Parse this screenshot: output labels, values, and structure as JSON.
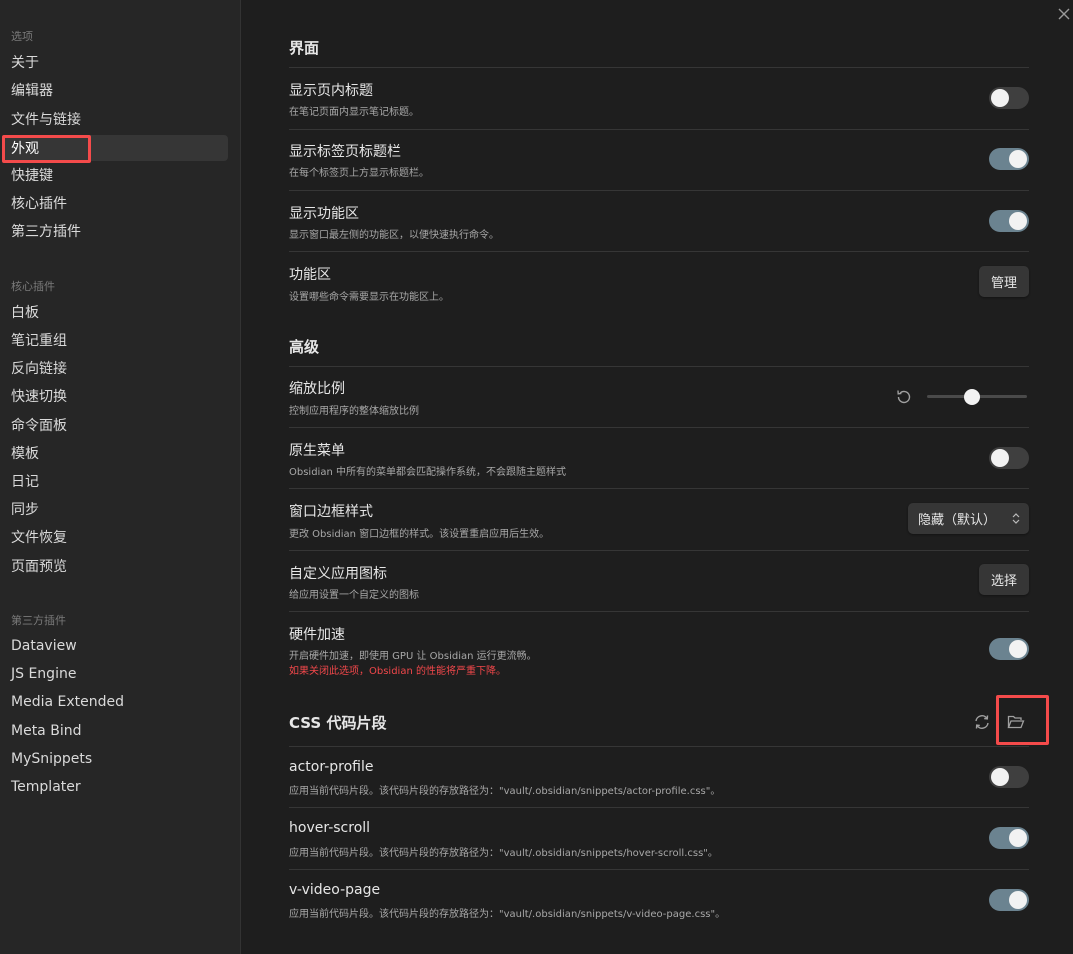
{
  "sidebar": {
    "group_options": "选项",
    "options": [
      "关于",
      "编辑器",
      "文件与链接",
      "外观",
      "快捷键",
      "核心插件",
      "第三方插件"
    ],
    "group_core": "核心插件",
    "core": [
      "白板",
      "笔记重组",
      "反向链接",
      "快速切换",
      "命令面板",
      "模板",
      "日记",
      "同步",
      "文件恢复",
      "页面预览"
    ],
    "group_third": "第三方插件",
    "third": [
      "Dataview",
      "JS Engine",
      "Media Extended",
      "Meta Bind",
      "MySnippets",
      "Templater"
    ]
  },
  "interface": {
    "title": "界面",
    "show_inline_title": {
      "name": "显示页内标题",
      "desc": "在笔记页面内显示笔记标题。",
      "enabled": false
    },
    "show_tab_title_bar": {
      "name": "显示标签页标题栏",
      "desc": "在每个标签页上方显示标题栏。",
      "enabled": true
    },
    "show_ribbon": {
      "name": "显示功能区",
      "desc": "显示窗口最左侧的功能区，以便快速执行命令。",
      "enabled": true
    },
    "ribbon": {
      "name": "功能区",
      "desc": "设置哪些命令需要显示在功能区上。",
      "button": "管理"
    }
  },
  "advanced": {
    "title": "高级",
    "zoom": {
      "name": "缩放比例",
      "desc": "控制应用程序的整体缩放比例",
      "level": 0.45,
      "icon": "reset-icon"
    },
    "native_menus": {
      "name": "原生菜单",
      "desc": "Obsidian 中所有的菜单都会匹配操作系统，不会跟随主题样式",
      "enabled": false
    },
    "frame_style": {
      "name": "窗口边框样式",
      "desc": "更改 Obsidian 窗口边框的样式。该设置重启应用后生效。",
      "value": "隐藏（默认）"
    },
    "custom_icon": {
      "name": "自定义应用图标",
      "desc": "给应用设置一个自定义的图标",
      "button": "选择"
    },
    "hardware_accel": {
      "name": "硬件加速",
      "desc": "开启硬件加速，即使用 GPU 让 Obsidian 运行更流畅。",
      "warning": "如果关闭此选项，Obsidian 的性能将严重下降。",
      "enabled": true
    }
  },
  "css": {
    "title": "CSS 代码片段",
    "snippets": [
      {
        "name": "actor-profile",
        "desc": "应用当前代码片段。该代码片段的存放路径为：\"vault/.obsidian/snippets/actor-profile.css\"。",
        "enabled": false
      },
      {
        "name": "hover-scroll",
        "desc": "应用当前代码片段。该代码片段的存放路径为：\"vault/.obsidian/snippets/hover-scroll.css\"。",
        "enabled": true
      },
      {
        "name": "v-video-page",
        "desc": "应用当前代码片段。该代码片段的存放路径为：\"vault/.obsidian/snippets/v-video-page.css\"。",
        "enabled": true
      }
    ]
  },
  "colors": {
    "accent_toggle": "#6b8390",
    "highlight": "#f44b4b",
    "warning": "#f0474a"
  }
}
